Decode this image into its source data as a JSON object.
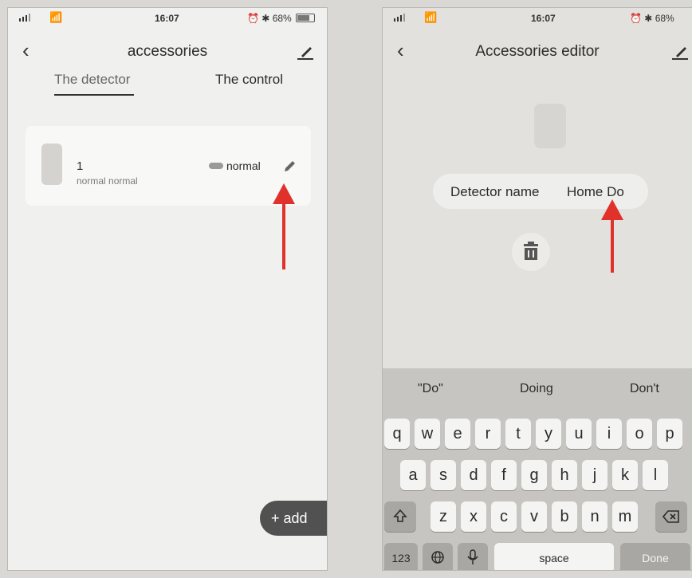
{
  "left": {
    "status": {
      "time": "16:07",
      "battery": "68%"
    },
    "title": "accessories",
    "tabs": [
      {
        "label": "The detector",
        "active": true
      },
      {
        "label": "The control",
        "active": false
      }
    ],
    "device": {
      "name": "1",
      "status_text": "normal normal",
      "state": "normal"
    },
    "add_label": "+ add"
  },
  "right": {
    "status": {
      "time": "16:07",
      "battery": "68%"
    },
    "title": "Accessories editor",
    "field": {
      "label": "Detector name",
      "value": "Home Do"
    },
    "suggestions": [
      "\"Do\"",
      "Doing",
      "Don't"
    ],
    "rows": [
      [
        "q",
        "w",
        "e",
        "r",
        "t",
        "y",
        "u",
        "i",
        "o",
        "p"
      ],
      [
        "a",
        "s",
        "d",
        "f",
        "g",
        "h",
        "j",
        "k",
        "l"
      ],
      [
        "z",
        "x",
        "c",
        "v",
        "b",
        "n",
        "m"
      ]
    ],
    "keys": {
      "numbers": "123",
      "space": "space",
      "done": "Done"
    }
  },
  "colors": {
    "annotation_arrow": "#e0312b",
    "add_button": "#515151",
    "keyboard_bg": "#c6c5c1"
  }
}
